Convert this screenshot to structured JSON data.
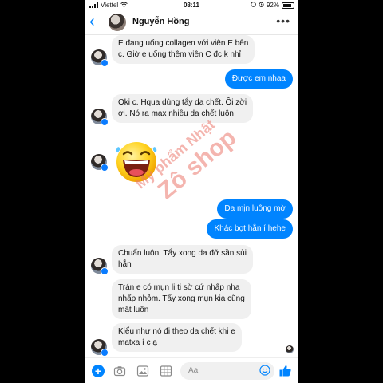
{
  "status_bar": {
    "carrier": "Viettel",
    "time": "08:11",
    "battery": "92%"
  },
  "header": {
    "contact_name": "Nguyễn Hồng"
  },
  "messages": [
    {
      "side": "in",
      "lines": [
        "E đang uống collagen với viên E bên",
        "c. Giờ e uống thêm viên C đc k nhỉ"
      ]
    },
    {
      "side": "out",
      "lines": [
        "Được em nhaa"
      ]
    },
    {
      "side": "in",
      "lines": [
        "Oki c. Hqua dùng tẩy da chết. Ôi zời",
        "ơi. Nó ra max nhiều da chết luôn"
      ]
    },
    {
      "side": "in",
      "type": "sticker",
      "sticker": "laughing-emoji"
    },
    {
      "side": "out",
      "lines": [
        "Da mịn luông mờ"
      ]
    },
    {
      "side": "out",
      "lines": [
        "Khác bọt hẳn í hehe"
      ]
    },
    {
      "side": "in",
      "lines": [
        "Chuẩn luôn. Tẩy xong da đỡ sần sùi",
        "hẳn"
      ]
    },
    {
      "side": "in",
      "lines": [
        "Trán e có mụn li ti sờ cứ nhấp nha",
        "nhấp nhỏm. Tẩy xong mụn kia cũng",
        "mất luôn"
      ]
    },
    {
      "side": "in",
      "lines": [
        "Kiểu như nó đi theo da chết khi e",
        "matxa í c ạ"
      ]
    }
  ],
  "watermark": {
    "line1": "Mỹ phẩm Nhật",
    "line2": "Zô shop"
  },
  "composer": {
    "placeholder": "Aa"
  },
  "colors": {
    "accent": "#0084ff",
    "incoming_bubble": "#f0f0f0"
  }
}
